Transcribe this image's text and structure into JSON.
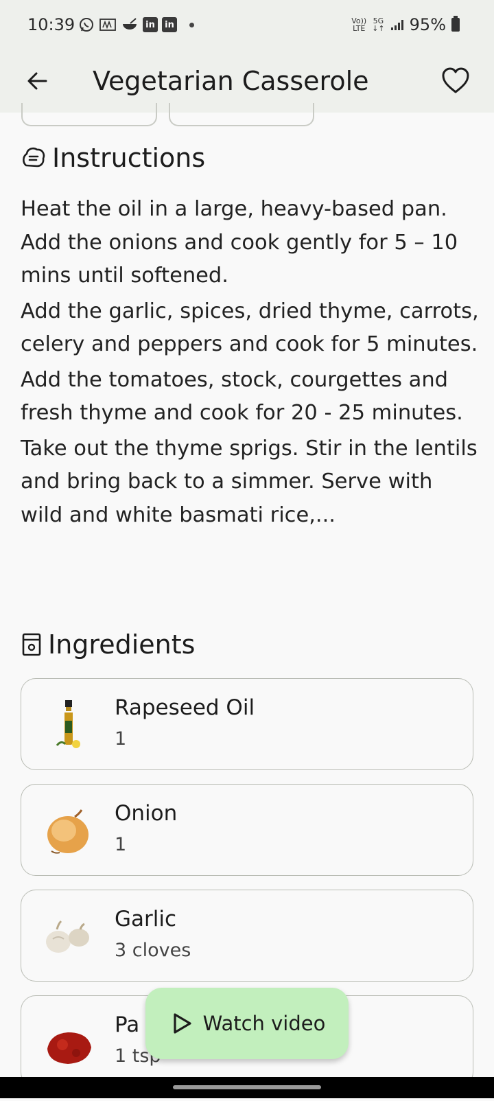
{
  "status_bar": {
    "time": "10:39",
    "battery": "95%",
    "network_label": "5G",
    "volte_label": "Vo)) LTE"
  },
  "app_bar": {
    "title": "Vegetarian Casserole",
    "back_icon": "arrow-left-icon",
    "favorite_icon": "heart-outline-icon"
  },
  "instructions": {
    "heading": "Instructions",
    "icon": "chef-hat-icon",
    "paragraphs": [
      "Heat the oil in a large, heavy-based pan. Add the onions and cook gently for 5 – 10 mins until softened.",
      "Add the garlic, spices, dried thyme, carrots, celery and peppers and cook for 5 minutes.",
      "Add the tomatoes, stock, courgettes and fresh thyme and cook for 20 - 25 minutes.",
      "Take out the thyme sprigs. Stir in the lentils and bring back to a simmer. Serve with wild and white basmati rice,..."
    ]
  },
  "ingredients": {
    "heading": "Ingredients",
    "icon": "fridge-icon",
    "items": [
      {
        "name": "Rapeseed Oil",
        "quantity": "1",
        "image": "oil-bottle"
      },
      {
        "name": "Onion",
        "quantity": "1",
        "image": "onion"
      },
      {
        "name": "Garlic",
        "quantity": "3 cloves",
        "image": "garlic"
      },
      {
        "name": "Pa",
        "quantity": "1 tsp",
        "image": "paprika"
      }
    ]
  },
  "fab": {
    "label": "Watch video",
    "icon": "play-icon"
  },
  "colors": {
    "app_bar_bg": "#eef0ec",
    "fab_bg": "#c2efbd",
    "page_bg": "#f9f9f9"
  }
}
